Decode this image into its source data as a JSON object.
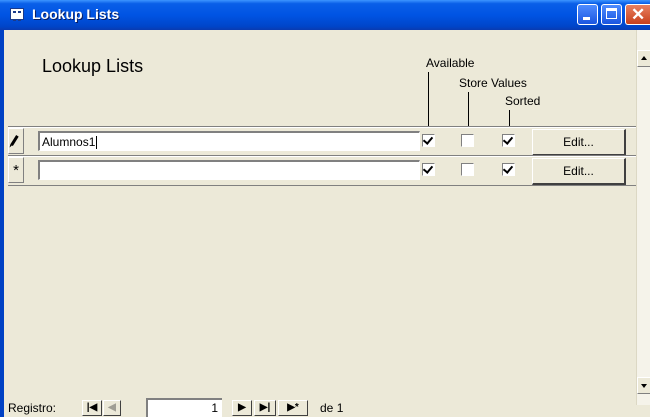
{
  "window": {
    "title": "Lookup Lists",
    "accent": "#0054e3"
  },
  "form": {
    "title": "Lookup Lists",
    "columns": {
      "available": "Available",
      "store_values": "Store Values",
      "sorted": "Sorted"
    }
  },
  "rows": [
    {
      "selector": "pencil-icon",
      "value": "Alumnos1",
      "available": true,
      "store_values": false,
      "sorted": true,
      "edit_label": "Edit..."
    },
    {
      "selector": "*",
      "value": "",
      "available": true,
      "store_values": false,
      "sorted": true,
      "edit_label": "Edit..."
    }
  ],
  "nav": {
    "label": "Registro:",
    "first": "|◀",
    "prev": "◀",
    "current": "1",
    "next": "▶",
    "last": "▶|",
    "new": "▶*",
    "of_label": "de",
    "total": "1"
  }
}
